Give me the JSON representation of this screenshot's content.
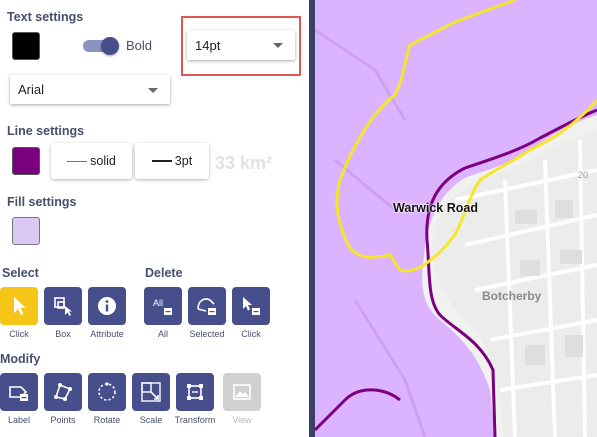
{
  "text_settings": {
    "title": "Text settings",
    "color": "#000000",
    "bold_label": "Bold",
    "bold_enabled": true,
    "size_value": "14pt",
    "font_value": "Arial"
  },
  "line_settings": {
    "title": "Line settings",
    "color": "#7b0080",
    "style_label": "solid",
    "width_label": "3pt"
  },
  "fill_settings": {
    "title": "Fill settings",
    "color": "#dcc8f5"
  },
  "select": {
    "title": "Select",
    "tools": [
      {
        "label": "Click",
        "icon": "cursor-icon",
        "active": true
      },
      {
        "label": "Box",
        "icon": "box-select-icon",
        "active": false
      },
      {
        "label": "Attribute",
        "icon": "info-icon",
        "active": false
      }
    ]
  },
  "delete": {
    "title": "Delete",
    "tools": [
      {
        "label": "All",
        "icon": "delete-all-icon"
      },
      {
        "label": "Selected",
        "icon": "delete-selected-icon"
      },
      {
        "label": "Click",
        "icon": "delete-click-icon"
      }
    ]
  },
  "modify": {
    "title": "Modify",
    "tools": [
      {
        "label": "Label",
        "icon": "label-tag-icon",
        "enabled": true
      },
      {
        "label": "Points",
        "icon": "edit-points-icon",
        "enabled": true
      },
      {
        "label": "Rotate",
        "icon": "rotate-icon",
        "enabled": true
      },
      {
        "label": "Scale",
        "icon": "scale-icon",
        "enabled": true
      },
      {
        "label": "Transform",
        "icon": "transform-icon",
        "enabled": true
      },
      {
        "label": "View",
        "icon": "view-image-icon",
        "enabled": false
      }
    ]
  },
  "ghost_area_text": "33 km²",
  "map": {
    "labels": {
      "warwick_road": "Warwick Road",
      "botcherby": "Botcherby",
      "road_number": "20"
    },
    "colors": {
      "polygon_fill": "#dcb3ff",
      "boundary_purple": "#7b0080",
      "boundary_yellow": "#f4e62c"
    }
  },
  "accent_color": "#474e8c"
}
